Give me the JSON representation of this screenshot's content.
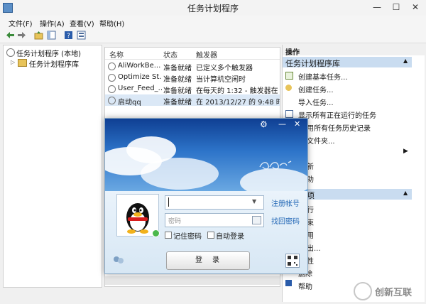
{
  "window": {
    "title": "任务计划程序",
    "minimize": "—",
    "maximize": "☐",
    "close": "✕"
  },
  "menubar": {
    "items": [
      "文件(F)",
      "操作(A)",
      "查看(V)",
      "帮助(H)"
    ]
  },
  "left_tree": {
    "root": "任务计划程序 (本地)",
    "child": "任务计划程序库"
  },
  "task_list": {
    "columns": [
      "名称",
      "状态",
      "触发器"
    ],
    "rows": [
      {
        "name": "AliWorkBe...",
        "status": "准备就绪",
        "trigger": "已定义多个触发器"
      },
      {
        "name": "Optimize St...",
        "status": "准备就绪",
        "trigger": "当计算机空闲时"
      },
      {
        "name": "User_Feed_...",
        "status": "准备就绪",
        "trigger": "在每天的 1:32 - 触发器在 2"
      },
      {
        "name": "启动qq",
        "status": "准备就绪",
        "trigger": "在 2013/12/27 的 9:48 时"
      }
    ]
  },
  "actions": {
    "header": "操作",
    "section_title": "任务计划程序库",
    "items": [
      "创建基本任务...",
      "创建任务...",
      "导入任务...",
      "显示所有正在运行的任务",
      "用所有任务历史记录",
      "文件夹...",
      "",
      "新",
      "助"
    ],
    "section2_items": [
      "行",
      "束",
      "用",
      "出...",
      "性",
      "删除",
      "帮助"
    ]
  },
  "qq": {
    "settings_icon": "⚙",
    "min": "—",
    "close": "✕",
    "account_placeholder": "",
    "password_placeholder": "密码",
    "register_link": "注册帐号",
    "recover_link": "找回密码",
    "remember_label": "记住密码",
    "autologin_label": "自动登录",
    "login_label": "登　录"
  },
  "watermark": {
    "text": "创新互联"
  }
}
